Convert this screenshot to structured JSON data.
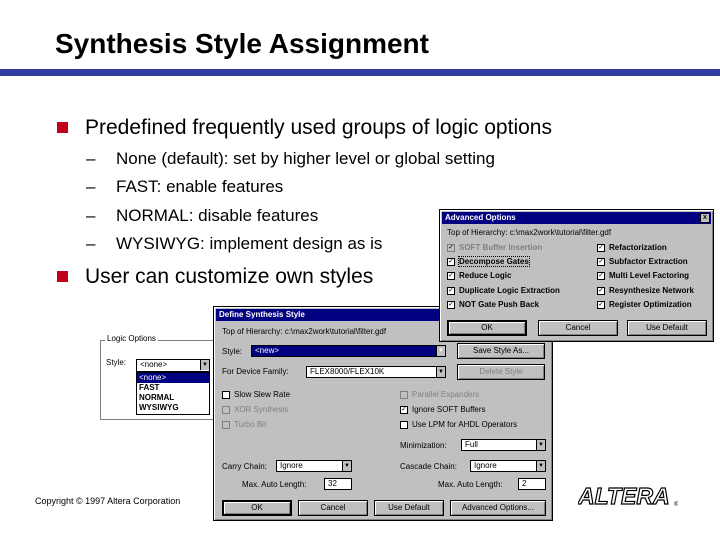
{
  "slide": {
    "title": "Synthesis Style Assignment",
    "bullet1": "Predefined frequently used groups of logic options",
    "subs": [
      "None (default):  set by higher level or global setting",
      "FAST:  enable features",
      "NORMAL:  disable features",
      "WYSIWYG:  implement design as is"
    ],
    "dash": "–",
    "bullet2": "User can customize own styles",
    "copyright": "Copyright © 1997 Altera Corporation",
    "logo_text": "ALTERA",
    "logo_reg": "®"
  },
  "logic_panel": {
    "title": "Logic Options",
    "style_label": "Style:",
    "combo_value": "<none>",
    "items": [
      "<none>",
      "FAST",
      "NORMAL",
      "WYSIWYG"
    ]
  },
  "define_dialog": {
    "title": "Define Synthesis Style",
    "top_hierarchy": "Top of Hierarchy: c:\\max2work\\tutorial\\filter.gdf",
    "style_label": "Style:",
    "style_value": "<new>",
    "save_style": "Save Style As...",
    "device_label": "For Device Family:",
    "device_value": "FLEX8000/FLEX10K",
    "delete_style": "Delete Style",
    "checks": {
      "slow_slew": "Slow Slew Rate",
      "xor": "XOR Synthesis",
      "turbo": "Turbo Bit",
      "parallel": "Parallel Expanders",
      "ignore_soft": "Ignore SOFT Buffers",
      "lpm": "Use LPM for AHDL Operators"
    },
    "minimization_label": "Minimization:",
    "minimization_value": "Full",
    "carry_label": "Carry Chain:",
    "carry_value": "Ignore",
    "cascade_label": "Cascade Chain:",
    "cascade_value": "Ignore",
    "max_auto_label": "Max. Auto Length:",
    "max_auto_1": "32",
    "max_auto_2": "2",
    "ok": "OK",
    "cancel": "Cancel",
    "use_default": "Use Default",
    "advanced": "Advanced Options..."
  },
  "advanced_dialog": {
    "title": "Advanced Options",
    "close_glyph": "x",
    "top_hierarchy": "Top of Hierarchy: c:\\max2work\\tutorial\\filter.gdf",
    "left": [
      "SOFT Buffer Insertion",
      "Decompose Gates",
      "Reduce Logic",
      "Duplicate Logic Extraction",
      "NOT Gate Push Back"
    ],
    "right": [
      "Refactorization",
      "Subfactor Extraction",
      "Multi Level Factoring",
      "Resynthesize Network",
      "Register Optimization"
    ],
    "ok": "OK",
    "cancel": "Cancel",
    "use_default": "Use Default"
  },
  "glyphs": {
    "check": "✓",
    "arrow": "▼"
  },
  "colors": {
    "title_bar": "#000080",
    "slide_rule": "#2f3c9e",
    "bullet": "#c0001a",
    "dialog_bg": "#c0c0c0"
  }
}
